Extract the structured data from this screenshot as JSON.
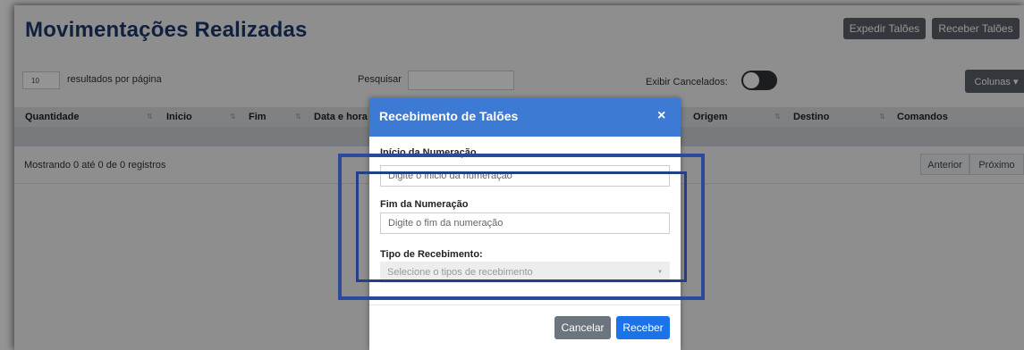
{
  "page": {
    "title": "Movimentações Realizadas",
    "buttons": {
      "expedir": "Expedir Talões",
      "receber": "Receber Talões"
    }
  },
  "controls": {
    "per_page_value": "10",
    "per_page_label": "resultados por página",
    "search_label": "Pesquisar",
    "search_value": "",
    "show_cancelled_label": "Exibir Cancelados:",
    "show_cancelled_on": false,
    "columns_button": "Colunas ▾"
  },
  "table": {
    "headers": [
      "Quantidade",
      "Inicio",
      "Fim",
      "Data e hora",
      "Origem",
      "Destino",
      "Comandos"
    ],
    "sort_icon": "⇅",
    "rows": []
  },
  "footer": {
    "info": "Mostrando 0 até 0 de 0 registros",
    "prev": "Anterior",
    "next": "Próximo"
  },
  "modal": {
    "title": "Recebimento de Talões",
    "close": "×",
    "fields": [
      {
        "label": "Início da Numeração",
        "placeholder": "Digite o inicio da numeração"
      },
      {
        "label": "Fim da Numeração",
        "placeholder": "Digite o fim da numeração"
      },
      {
        "label": "Tipo de Recebimento:",
        "placeholder": "Selecione o tipos de recebimento"
      }
    ],
    "cancel": "Cancelar",
    "submit": "Receber"
  },
  "colors": {
    "title": "#1b3a6b",
    "modal_header": "#3c7ad3",
    "primary": "#1a73e8",
    "secondary": "#6c757d",
    "highlight": "#2d4a9a"
  }
}
